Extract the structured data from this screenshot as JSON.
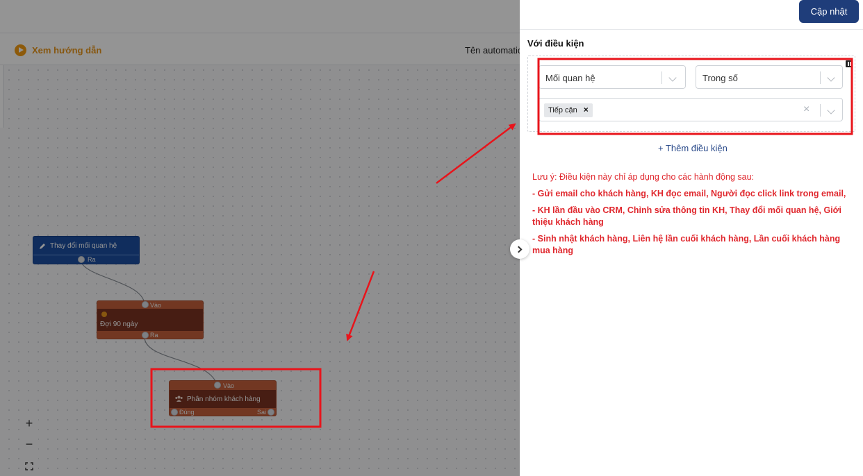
{
  "header": {
    "guide_link": "Xem hướng dẫn",
    "automation_name_label": "Tên automation"
  },
  "canvas": {
    "nodes": [
      {
        "title": "Thay đổi mối quan hệ",
        "ports": [
          "Ra"
        ]
      },
      {
        "title": "Đợi 90 ngày",
        "ports": [
          "Vào",
          "Ra"
        ]
      },
      {
        "title": "Phân nhóm khách hàng",
        "ports": [
          "Vào",
          "Đúng",
          "Sai"
        ]
      }
    ],
    "zoom": {
      "in": "+",
      "out": "−"
    }
  },
  "panel": {
    "update_button": "Cập nhật",
    "condition_title": "Với điều kiện",
    "condition": {
      "field": "Mối quan hệ",
      "operator": "Trong số",
      "values": [
        "Tiếp cận"
      ]
    },
    "add_condition": "+ Thêm điều kiện",
    "note": {
      "intro": "Lưu ý: Điều kiện này chỉ áp dụng cho các hành động sau:",
      "items": [
        "- Gửi email cho khách hàng, KH đọc email, Người đọc click link trong email,",
        "- KH lần đầu vào CRM, Chỉnh sửa thông tin KH, Thay đổi mối quan hệ, Giới thiệu khách hàng",
        "- Sinh nhật khách hàng, Liên hệ lần cuối khách hàng, Lần cuối khách hàng mua hàng"
      ]
    }
  },
  "colors": {
    "primary": "#1f3d7a",
    "note": "#e0282e",
    "annotation": "#e8141b",
    "node_blue": "#1d4ea0",
    "node_orange": "#c4603b"
  }
}
